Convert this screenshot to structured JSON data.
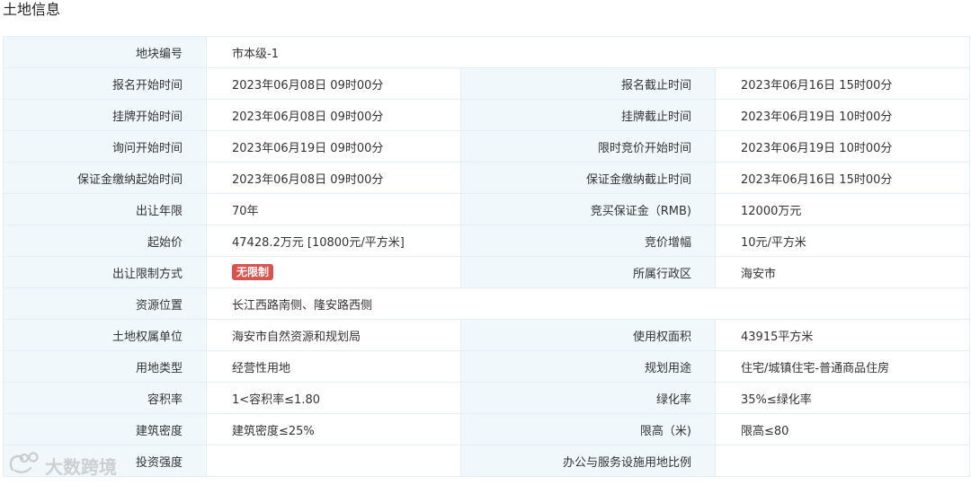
{
  "page_title": "土地信息",
  "rows": [
    {
      "l1": "地块编号",
      "v1": "市本级-1"
    },
    {
      "l1": "报名开始时间",
      "v1": "2023年06月08日 09时00分",
      "l2": "报名截止时间",
      "v2": "2023年06月16日 15时00分"
    },
    {
      "l1": "挂牌开始时间",
      "v1": "2023年06月08日 09时00分",
      "l2": "挂牌截止时间",
      "v2": "2023年06月19日 10时00分"
    },
    {
      "l1": "询问开始时间",
      "v1": "2023年06月19日 09时00分",
      "l2": "限时竞价开始时间",
      "v2": "2023年06月19日 10时00分"
    },
    {
      "l1": "保证金缴纳起始时间",
      "v1": "2023年06月08日 09时00分",
      "l2": "保证金缴纳截止时间",
      "v2": "2023年06月16日 15时00分"
    },
    {
      "l1": "出让年限",
      "v1": "70年",
      "l2": "竞买保证金（RMB)",
      "v2": "12000万元"
    },
    {
      "l1": "起始价",
      "v1": "47428.2万元 [10800元/平方米]",
      "l2": "竞价增幅",
      "v2": "10元/平方米"
    },
    {
      "l1": "出让限制方式",
      "badge": "无限制",
      "l2": "所属行政区",
      "v2": "海安市"
    },
    {
      "l1": "资源位置",
      "v1": "长江西路南侧、隆安路西侧"
    },
    {
      "l1": "土地权属单位",
      "v1": "海安市自然资源和规划局",
      "l2": "使用权面积",
      "v2": "43915平方米"
    },
    {
      "l1": "用地类型",
      "v1": "经营性用地",
      "l2": "规划用途",
      "v2": "住宅/城镇住宅-普通商品住房"
    },
    {
      "l1": "容积率",
      "v1": "1<容积率≤1.80",
      "l2": "绿化率",
      "v2": "35%≤绿化率"
    },
    {
      "l1": "建筑密度",
      "v1": "建筑密度≤25%",
      "l2": "限高（米)",
      "v2": "限高≤80"
    },
    {
      "l1": "投资强度",
      "v1": "",
      "l2": "办公与服务设施用地比例",
      "v2": ""
    }
  ],
  "watermark": "大数跨境",
  "colors": {
    "label_bg": "#f1f8fc",
    "border": "#e6eef5",
    "badge": "#d9534f"
  }
}
